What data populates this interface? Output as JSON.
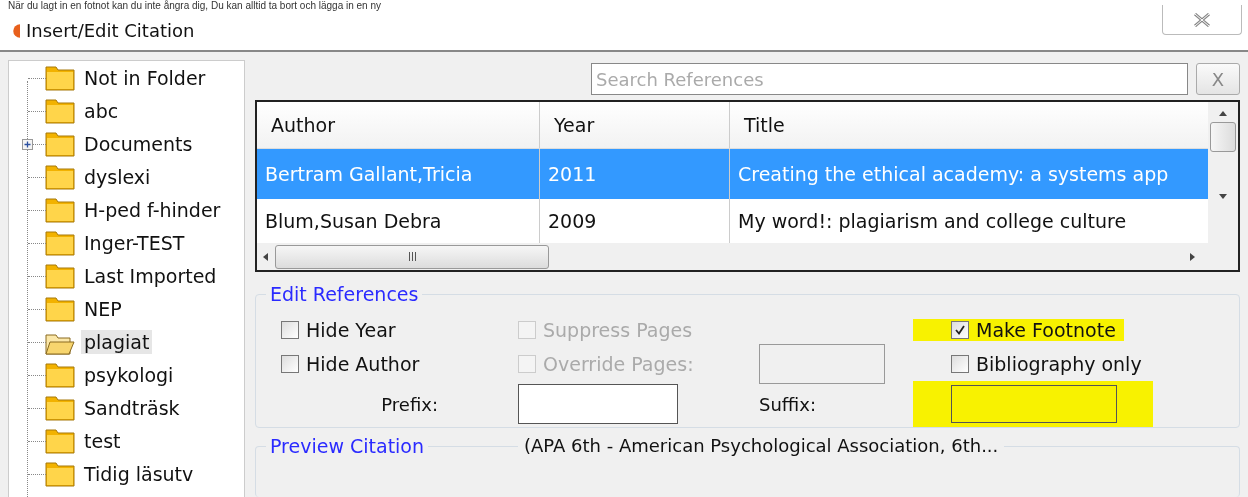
{
  "caption": "När du lagt in en fotnot kan du inte ångra dig, Du kan alltid ta bort och lägga in en ny",
  "window": {
    "title": "Insert/Edit Citation"
  },
  "folders": [
    {
      "label": "Not in Folder",
      "selected": false,
      "expandable": false
    },
    {
      "label": "abc",
      "selected": false,
      "expandable": false
    },
    {
      "label": "Documents",
      "selected": false,
      "expandable": true
    },
    {
      "label": "dyslexi",
      "selected": false,
      "expandable": false
    },
    {
      "label": "H-ped f-hinder",
      "selected": false,
      "expandable": false
    },
    {
      "label": "Inger-TEST",
      "selected": false,
      "expandable": false
    },
    {
      "label": "Last Imported",
      "selected": false,
      "expandable": false
    },
    {
      "label": "NEP",
      "selected": false,
      "expandable": false
    },
    {
      "label": "plagiat",
      "selected": true,
      "expandable": false
    },
    {
      "label": "psykologi",
      "selected": false,
      "expandable": false
    },
    {
      "label": "Sandträsk",
      "selected": false,
      "expandable": false
    },
    {
      "label": "test",
      "selected": false,
      "expandable": false
    },
    {
      "label": "Tidig läsutv",
      "selected": false,
      "expandable": false
    }
  ],
  "search": {
    "placeholder": "Search References",
    "clear_label": "X"
  },
  "table": {
    "columns": [
      "Author",
      "Year",
      "Title"
    ],
    "rows": [
      {
        "cells": [
          "Bertram Gallant,Tricia",
          "2011",
          "Creating the ethical academy: a systems app"
        ],
        "selected": true
      },
      {
        "cells": [
          "Blum,Susan Debra",
          "2009",
          "My word!: plagiarism and college culture"
        ],
        "selected": false
      }
    ]
  },
  "edit_references": {
    "title": "Edit References",
    "options": [
      {
        "label": "Hide Year",
        "checked": false,
        "disabled": false,
        "highlighted": false
      },
      {
        "label": "Hide Author",
        "checked": false,
        "disabled": false,
        "highlighted": false
      },
      {
        "label": "Suppress Pages",
        "checked": false,
        "disabled": true,
        "highlighted": false
      },
      {
        "label": "Override Pages:",
        "checked": false,
        "disabled": true,
        "highlighted": false
      },
      {
        "label": "Make Footnote",
        "checked": true,
        "disabled": false,
        "highlighted": true
      },
      {
        "label": "Bibliography only",
        "checked": false,
        "disabled": false,
        "highlighted": false
      }
    ],
    "prefix_label": "Prefix:",
    "suffix_label": "Suffix:",
    "suffix_highlighted": true
  },
  "preview": {
    "title": "Preview Citation",
    "style": "(APA 6th - American Psychological Association, 6th..."
  }
}
